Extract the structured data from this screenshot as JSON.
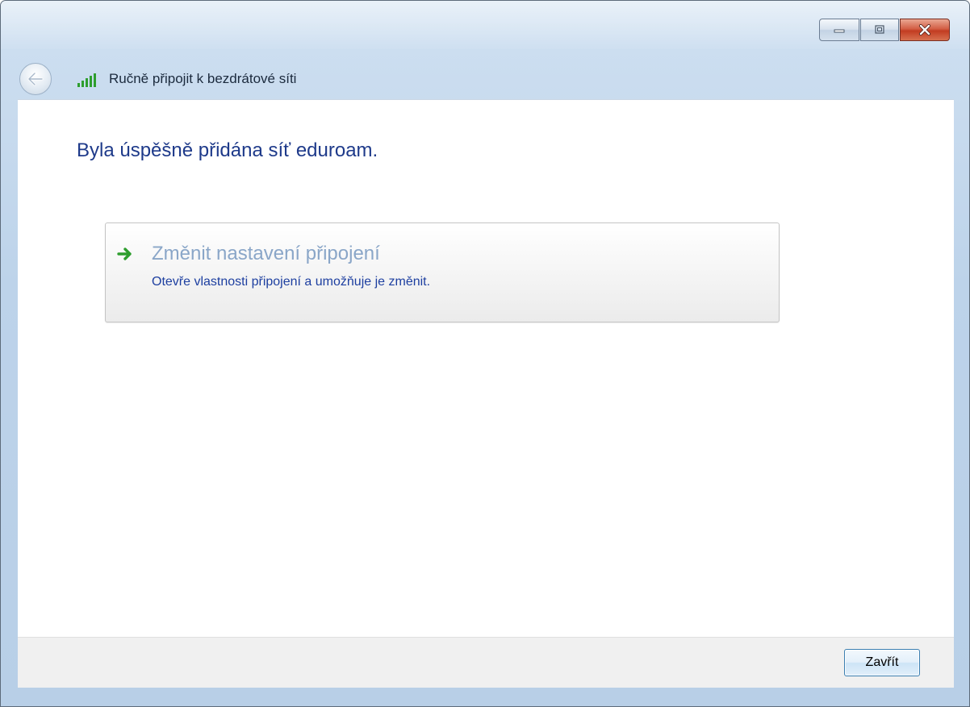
{
  "window": {
    "title": "Ručně připojit k bezdrátové síti",
    "caption": {
      "minimize_icon": "minimize-icon",
      "maximize_icon": "maximize-icon",
      "close_icon": "close-icon"
    }
  },
  "nav": {
    "back_icon": "back-arrow-icon",
    "network_icon": "wireless-signal-icon"
  },
  "main": {
    "heading": "Byla úspěšně přidána síť eduroam.",
    "link": {
      "icon": "green-arrow-icon",
      "title": "Změnit nastavení připojení",
      "description": "Otevře vlastnosti připojení a umožňuje je změnit."
    }
  },
  "footer": {
    "close_label": "Zavřít"
  },
  "colors": {
    "heading": "#1e3a8a",
    "link_title": "#8aa6c8",
    "link_description": "#1d3fa0",
    "accent_green": "#2e9e2e",
    "close_button_red": "#c23c22"
  }
}
